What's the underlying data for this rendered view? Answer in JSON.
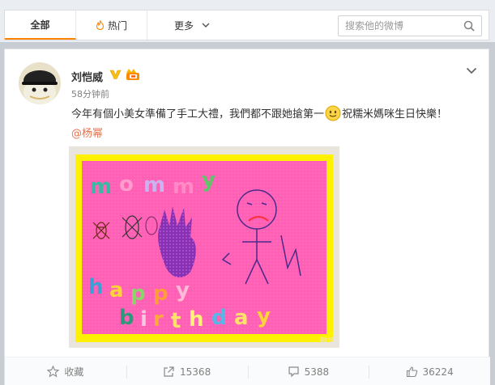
{
  "tabs": [
    {
      "label": "全部",
      "active": true
    },
    {
      "label": "热门",
      "icon": "fire-icon"
    },
    {
      "label": "更多",
      "icon": "chevron-down-icon"
    }
  ],
  "search": {
    "placeholder": "搜索他的微博",
    "icon": "search-icon"
  },
  "post": {
    "username": "刘恺威",
    "verified_badge": "verified-v-icon",
    "member_badge": "member-badge-icon",
    "time": "58分钟前",
    "text_part1": "今年有個小美女準備了手工大禮，我們都不跟她搶第一",
    "emoji": "smiley-emoji-icon",
    "text_part2": "祝糯米媽咪生日快樂！",
    "mention": "@杨幂",
    "image": {
      "description_letters": [
        "m",
        "o",
        "m",
        "m",
        "y",
        "h",
        "a",
        "p",
        "p",
        "y",
        "b",
        "i",
        "r",
        "t",
        "h",
        "d",
        "a",
        "y"
      ],
      "watermark": "微博"
    }
  },
  "actions": [
    {
      "label": "收藏",
      "icon": "star-icon"
    },
    {
      "label": "15368",
      "icon": "share-icon"
    },
    {
      "label": "5388",
      "icon": "comment-icon"
    },
    {
      "label": "36224",
      "icon": "thumbs-up-icon"
    }
  ],
  "colors": {
    "accent": "#ff8200",
    "link": "#eb7350",
    "card_pink": "#ff5fb4",
    "card_yellow": "#fff100"
  }
}
